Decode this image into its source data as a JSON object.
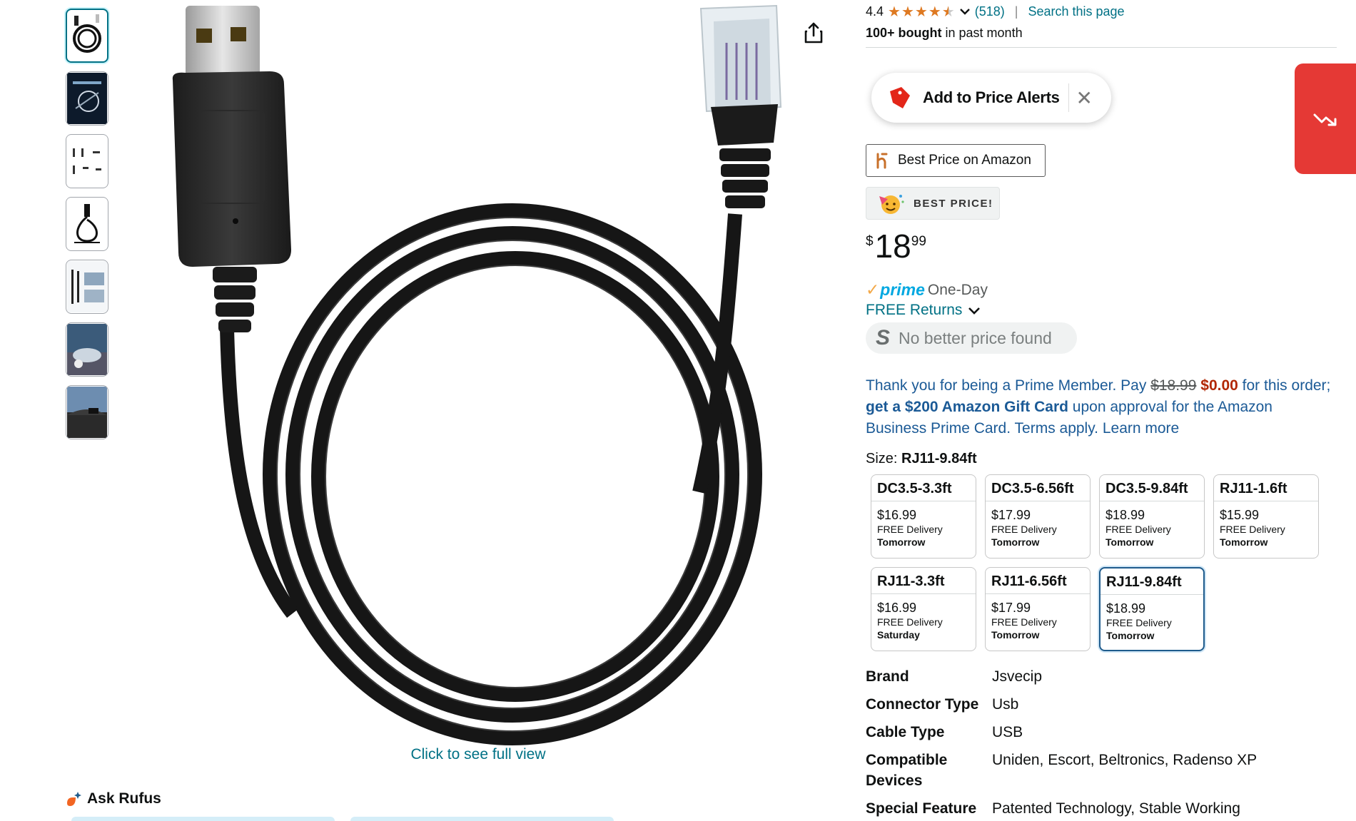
{
  "gallery": {
    "thumbnails": [
      {
        "name": "thumb-cable-coil"
      },
      {
        "name": "thumb-package-diagram"
      },
      {
        "name": "thumb-dimensions"
      },
      {
        "name": "thumb-cable-detail"
      },
      {
        "name": "thumb-application"
      },
      {
        "name": "thumb-car-dashboard"
      },
      {
        "name": "thumb-car-interior"
      }
    ],
    "full_view_label": "Click to see full view"
  },
  "rufus": {
    "label": "Ask Rufus"
  },
  "rating": {
    "value": "4.4",
    "stars": 4.5,
    "count": "(518)",
    "search_link": "Search this page"
  },
  "bought": {
    "bold": "100+ bought",
    "rest": " in past month"
  },
  "price_alert": {
    "label": "Add to Price Alerts"
  },
  "badges": {
    "best_amazon": "Best Price on Amazon",
    "best_price": "BEST PRICE!"
  },
  "price": {
    "symbol": "$",
    "whole": "18",
    "fraction": "99"
  },
  "delivery": {
    "prime_label": "prime",
    "speed": "One-Day",
    "returns": "FREE Returns",
    "no_better": "No better price found"
  },
  "promo": {
    "part1": "Thank you for being a Prime Member. Pay ",
    "old_price": "$18.99",
    "new_price": "$0.00",
    "part2": " for this order; ",
    "bold": "get a $200 Amazon Gift Card",
    "part3": " upon approval for the Amazon Business Prime Card. Terms apply. ",
    "learn_more": "Learn more"
  },
  "size": {
    "label": "Size: ",
    "selected": "RJ11-9.84ft",
    "options": [
      {
        "name": "DC3.5-3.3ft",
        "price": "$16.99",
        "delivery": "FREE Delivery",
        "when": "Tomorrow"
      },
      {
        "name": "DC3.5-6.56ft",
        "price": "$17.99",
        "delivery": "FREE Delivery",
        "when": "Tomorrow"
      },
      {
        "name": "DC3.5-9.84ft",
        "price": "$18.99",
        "delivery": "FREE Delivery",
        "when": "Tomorrow"
      },
      {
        "name": "RJ11-1.6ft",
        "price": "$15.99",
        "delivery": "FREE Delivery",
        "when": "Tomorrow"
      },
      {
        "name": "RJ11-3.3ft",
        "price": "$16.99",
        "delivery": "FREE Delivery",
        "when": "Saturday"
      },
      {
        "name": "RJ11-6.56ft",
        "price": "$17.99",
        "delivery": "FREE Delivery",
        "when": "Tomorrow"
      },
      {
        "name": "RJ11-9.84ft",
        "price": "$18.99",
        "delivery": "FREE Delivery",
        "when": "Tomorrow"
      }
    ]
  },
  "specs": [
    {
      "key": "Brand",
      "value": "Jsvecip"
    },
    {
      "key": "Connector Type",
      "value": "Usb"
    },
    {
      "key": "Cable Type",
      "value": "USB"
    },
    {
      "key": "Compatible Devices",
      "value": "Uniden, Escort, Beltronics, Radenso XP"
    },
    {
      "key": "Special Feature",
      "value": "Patented Technology, Stable Working"
    }
  ],
  "colors": {
    "link": "#007185",
    "star": "#de7921",
    "prime": "#00a8e1",
    "price_red": "#b12704",
    "alert_red": "#e53935",
    "selected_border": "#1f5b8c"
  }
}
